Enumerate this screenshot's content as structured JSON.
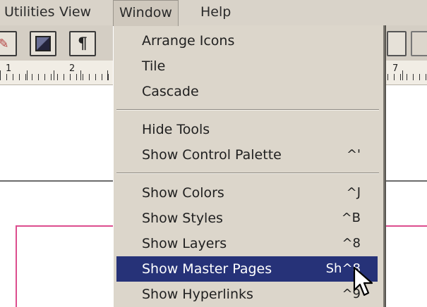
{
  "menubar": {
    "items": [
      {
        "label": "Utilities"
      },
      {
        "label": "View"
      },
      {
        "label": "Window"
      },
      {
        "label": "Help"
      }
    ]
  },
  "toolbar": {
    "buttons": [
      "pen-tool-icon",
      "frame-tool-icon",
      "paragraph-icon"
    ]
  },
  "ruler": {
    "marks": [
      "1",
      "2",
      "7"
    ]
  },
  "window_menu": {
    "groups": [
      [
        {
          "label": "Arrange Icons",
          "shortcut": ""
        },
        {
          "label": "Tile",
          "shortcut": ""
        },
        {
          "label": "Cascade",
          "shortcut": ""
        }
      ],
      [
        {
          "label": "Hide Tools",
          "shortcut": ""
        },
        {
          "label": "Show Control Palette",
          "shortcut": "^'"
        }
      ],
      [
        {
          "label": "Show Colors",
          "shortcut": "^J"
        },
        {
          "label": "Show Styles",
          "shortcut": "^B"
        },
        {
          "label": "Show Layers",
          "shortcut": "^8"
        },
        {
          "label": "Show Master Pages",
          "shortcut": "Sh^8",
          "highlighted": true
        },
        {
          "label": "Show Hyperlinks",
          "shortcut": "^9"
        }
      ]
    ]
  },
  "colors": {
    "menu_highlight": "#263278",
    "menu_background": "#dcd6cb",
    "guide_magenta": "#dc4d8e"
  }
}
